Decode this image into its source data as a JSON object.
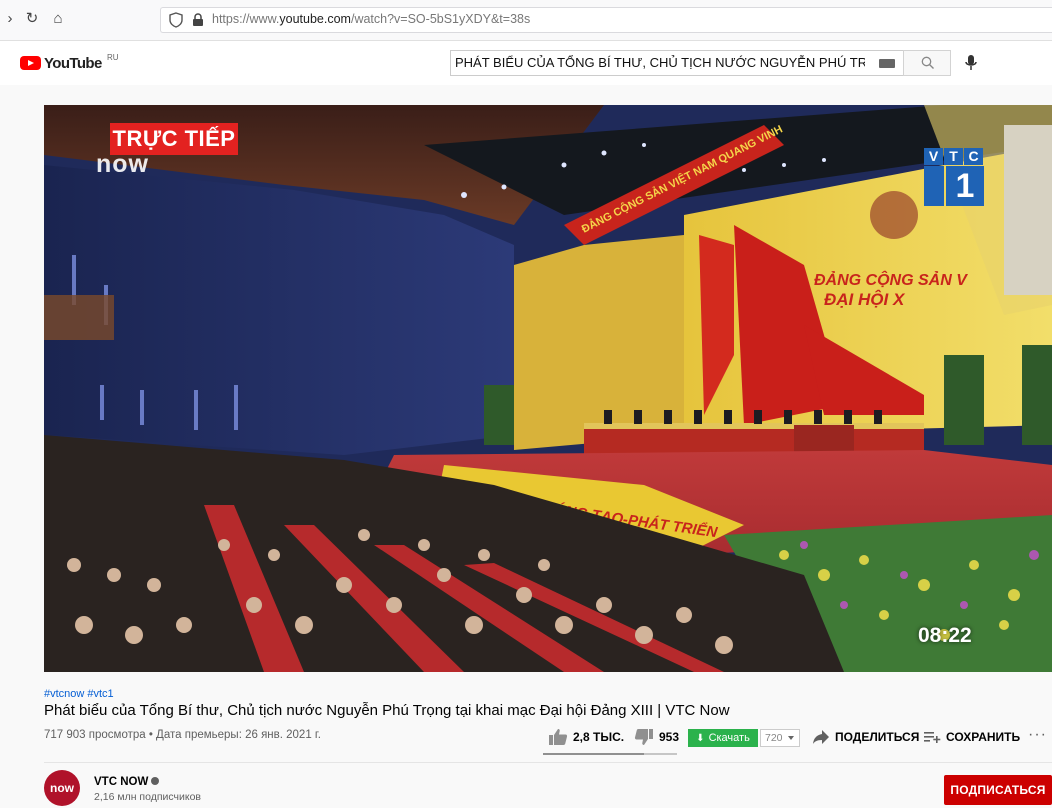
{
  "browser": {
    "url_prefix": "https://www.",
    "url_domain": "youtube.com",
    "url_path": "/watch?v=SO-5bS1yXDY&t=38s",
    "icons": [
      "back-arrow-icon",
      "reload-icon",
      "home-icon",
      "shield-icon",
      "lock-icon"
    ]
  },
  "header": {
    "logo_text": "YouTube",
    "country_code": "RU",
    "search_value": "PHÁT BIỂU CỦA TỔNG BÍ THƯ, CHỦ TỊCH NƯỚC NGUYỄN PHÚ TRỌNG",
    "icons": [
      "keyboard-icon",
      "search-icon",
      "microphone-icon"
    ]
  },
  "player": {
    "live_badge": "TRỰC TIẾP",
    "channel_watermark": "now",
    "vtc_letters": [
      "V",
      "T",
      "C"
    ],
    "vtc_number": "1",
    "timecode": "08:22",
    "banner_left": "ĐẢNG CỘNG SẢN VIỆT NAM QUANG VINH",
    "stage_line1": "ĐẢNG CỘNG SẢN V",
    "stage_line2": "ĐẠI HỘI X",
    "carpet_banner": "SÁNG TẠO-PHÁT TRIỂN",
    "colors": {
      "live_red": "#e32220",
      "vtc_blue": "#1f63b5",
      "stage_red": "#c8241c",
      "stage_yellow": "#e8c93a"
    }
  },
  "video": {
    "hashtags": [
      "#vtcnow",
      "#vtc1"
    ],
    "title": "Phát biểu của Tổng Bí thư, Chủ tịch nước Nguyễn Phú Trọng tại khai mạc Đại hội Đảng XIII | VTC Now",
    "views_date": "717 903 просмотра • Дата премьеры: 26 янв. 2021 г.",
    "likes": "2,8 ТЫС.",
    "dislikes": "953",
    "like_ratio": 0.75,
    "download_label": "Скачать",
    "quality": "720",
    "share_label": "ПОДЕЛИТЬСЯ",
    "save_label": "СОХРАНИТЬ",
    "more_label": "···",
    "icons": [
      "thumbs-up-icon",
      "thumbs-down-icon",
      "download-arrow-icon",
      "share-icon",
      "save-playlist-icon",
      "more-icon"
    ]
  },
  "channel": {
    "avatar_text": "now",
    "name": "VTC NOW",
    "subscribers": "2,16 млн подписчиков",
    "subscribe_label": "ПОДПИСАТЬСЯ"
  }
}
